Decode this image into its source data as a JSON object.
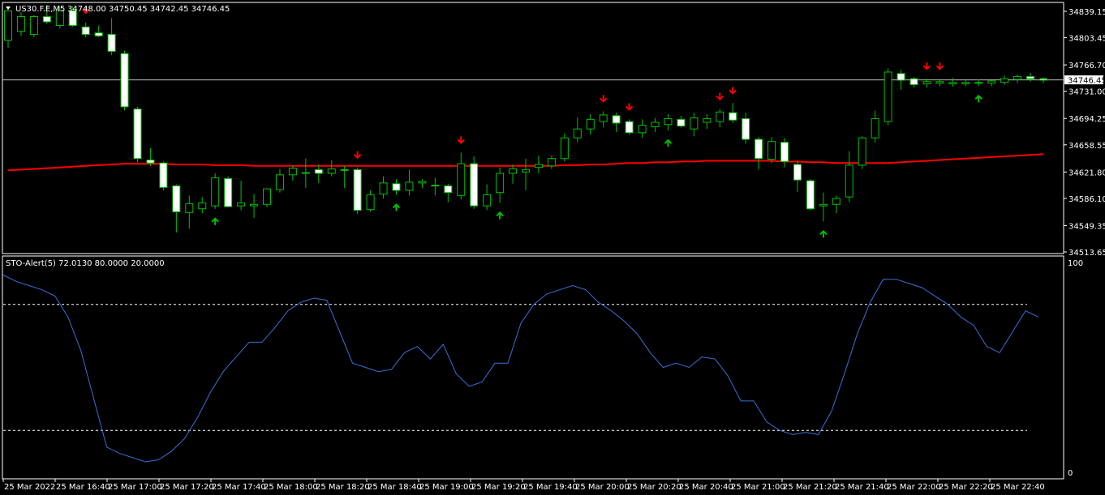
{
  "window": {
    "symbol_title": "US30.F.E,M5",
    "ohlc": "34748.00 34750.45 34742.45 34746.45",
    "indicator_title": "STO-Alert(5) 72.0130 80.0000 20.0000"
  },
  "colors": {
    "background": "#000000",
    "frame": "#ffffff",
    "bull_body": "#000000",
    "bear_body": "#ffffff",
    "wick": "#00c000",
    "ma_line": "#ff0000",
    "stoch_line": "#3b6fd6",
    "level_lines": "#ffffff",
    "arrow_up": "#00c000",
    "arrow_down": "#ff0000",
    "current_price_line": "#c0c0c0"
  },
  "chart_data": [
    {
      "type": "candlestick",
      "symbol": "US30.F.E",
      "timeframe": "M5",
      "current_price": 34746.45,
      "ylim": [
        34513.65,
        34852.0
      ],
      "y_ticks": [
        34839.15,
        34803.45,
        34766.7,
        34731.0,
        34694.25,
        34658.55,
        34621.8,
        34586.1,
        34549.35,
        34513.65
      ],
      "x_tick_labels": [
        "25 Mar 2022",
        "25 Mar 16:40",
        "25 Mar 17:00",
        "25 Mar 17:20",
        "25 Mar 17:40",
        "25 Mar 18:00",
        "25 Mar 18:20",
        "25 Mar 18:40",
        "25 Mar 19:00",
        "25 Mar 19:20",
        "25 Mar 19:40",
        "25 Mar 20:00",
        "25 Mar 20:20",
        "25 Mar 20:40",
        "25 Mar 21:00",
        "25 Mar 21:20",
        "25 Mar 21:40",
        "25 Mar 22:00",
        "25 Mar 22:20",
        "25 Mar 22:40"
      ],
      "candles": [
        {
          "o": 34800,
          "h": 34845,
          "l": 34790,
          "c": 34840
        },
        {
          "o": 34812,
          "h": 34838,
          "l": 34806,
          "c": 34832
        },
        {
          "o": 34808,
          "h": 34834,
          "l": 34804,
          "c": 34832
        },
        {
          "o": 34832,
          "h": 34848,
          "l": 34822,
          "c": 34825
        },
        {
          "o": 34820,
          "h": 34846,
          "l": 34816,
          "c": 34840
        },
        {
          "o": 34840,
          "h": 34846,
          "l": 34818,
          "c": 34820
        },
        {
          "o": 34818,
          "h": 34824,
          "l": 34804,
          "c": 34808
        },
        {
          "o": 34810,
          "h": 34820,
          "l": 34804,
          "c": 34806
        },
        {
          "o": 34808,
          "h": 34830,
          "l": 34780,
          "c": 34785
        },
        {
          "o": 34782,
          "h": 34786,
          "l": 34705,
          "c": 34710
        },
        {
          "o": 34707,
          "h": 34710,
          "l": 34635,
          "c": 34640
        },
        {
          "o": 34638,
          "h": 34654,
          "l": 34630,
          "c": 34634
        },
        {
          "o": 34634,
          "h": 34636,
          "l": 34597,
          "c": 34601
        },
        {
          "o": 34603,
          "h": 34605,
          "l": 34540,
          "c": 34568
        },
        {
          "o": 34567,
          "h": 34590,
          "l": 34545,
          "c": 34579
        },
        {
          "o": 34572,
          "h": 34588,
          "l": 34566,
          "c": 34580
        },
        {
          "o": 34576,
          "h": 34620,
          "l": 34572,
          "c": 34614
        },
        {
          "o": 34613,
          "h": 34616,
          "l": 34574,
          "c": 34575
        },
        {
          "o": 34576,
          "h": 34610,
          "l": 34570,
          "c": 34580
        },
        {
          "o": 34576,
          "h": 34592,
          "l": 34560,
          "c": 34578
        },
        {
          "o": 34578,
          "h": 34600,
          "l": 34574,
          "c": 34599
        },
        {
          "o": 34598,
          "h": 34626,
          "l": 34594,
          "c": 34618
        },
        {
          "o": 34618,
          "h": 34630,
          "l": 34610,
          "c": 34627
        },
        {
          "o": 34620,
          "h": 34640,
          "l": 34600,
          "c": 34621
        },
        {
          "o": 34625,
          "h": 34632,
          "l": 34607,
          "c": 34620
        },
        {
          "o": 34620,
          "h": 34638,
          "l": 34616,
          "c": 34626
        },
        {
          "o": 34625,
          "h": 34630,
          "l": 34600,
          "c": 34624
        },
        {
          "o": 34625,
          "h": 34628,
          "l": 34565,
          "c": 34570
        },
        {
          "o": 34571,
          "h": 34597,
          "l": 34568,
          "c": 34591
        },
        {
          "o": 34592,
          "h": 34616,
          "l": 34586,
          "c": 34607
        },
        {
          "o": 34606,
          "h": 34612,
          "l": 34591,
          "c": 34597
        },
        {
          "o": 34597,
          "h": 34625,
          "l": 34590,
          "c": 34608
        },
        {
          "o": 34607,
          "h": 34612,
          "l": 34600,
          "c": 34609
        },
        {
          "o": 34604,
          "h": 34614,
          "l": 34590,
          "c": 34603
        },
        {
          "o": 34603,
          "h": 34606,
          "l": 34581,
          "c": 34594
        },
        {
          "o": 34590,
          "h": 34648,
          "l": 34585,
          "c": 34633
        },
        {
          "o": 34633,
          "h": 34643,
          "l": 34572,
          "c": 34576
        },
        {
          "o": 34576,
          "h": 34605,
          "l": 34570,
          "c": 34591
        },
        {
          "o": 34594,
          "h": 34628,
          "l": 34580,
          "c": 34620
        },
        {
          "o": 34620,
          "h": 34632,
          "l": 34606,
          "c": 34626
        },
        {
          "o": 34622,
          "h": 34640,
          "l": 34597,
          "c": 34625
        },
        {
          "o": 34628,
          "h": 34644,
          "l": 34620,
          "c": 34632
        },
        {
          "o": 34630,
          "h": 34644,
          "l": 34626,
          "c": 34640
        },
        {
          "o": 34640,
          "h": 34674,
          "l": 34636,
          "c": 34668
        },
        {
          "o": 34668,
          "h": 34696,
          "l": 34662,
          "c": 34680
        },
        {
          "o": 34680,
          "h": 34700,
          "l": 34672,
          "c": 34693
        },
        {
          "o": 34690,
          "h": 34704,
          "l": 34682,
          "c": 34699
        },
        {
          "o": 34698,
          "h": 34702,
          "l": 34676,
          "c": 34688
        },
        {
          "o": 34690,
          "h": 34693,
          "l": 34672,
          "c": 34675
        },
        {
          "o": 34675,
          "h": 34693,
          "l": 34668,
          "c": 34685
        },
        {
          "o": 34683,
          "h": 34695,
          "l": 34676,
          "c": 34689
        },
        {
          "o": 34686,
          "h": 34700,
          "l": 34678,
          "c": 34694
        },
        {
          "o": 34693,
          "h": 34698,
          "l": 34682,
          "c": 34684
        },
        {
          "o": 34680,
          "h": 34702,
          "l": 34670,
          "c": 34695
        },
        {
          "o": 34689,
          "h": 34700,
          "l": 34680,
          "c": 34694
        },
        {
          "o": 34690,
          "h": 34707,
          "l": 34682,
          "c": 34703
        },
        {
          "o": 34702,
          "h": 34715,
          "l": 34688,
          "c": 34692
        },
        {
          "o": 34694,
          "h": 34702,
          "l": 34660,
          "c": 34666
        },
        {
          "o": 34666,
          "h": 34669,
          "l": 34625,
          "c": 34640
        },
        {
          "o": 34639,
          "h": 34669,
          "l": 34634,
          "c": 34663
        },
        {
          "o": 34662,
          "h": 34668,
          "l": 34628,
          "c": 34636
        },
        {
          "o": 34632,
          "h": 34637,
          "l": 34595,
          "c": 34611
        },
        {
          "o": 34610,
          "h": 34612,
          "l": 34570,
          "c": 34572
        },
        {
          "o": 34576,
          "h": 34594,
          "l": 34555,
          "c": 34578
        },
        {
          "o": 34578,
          "h": 34590,
          "l": 34566,
          "c": 34586
        },
        {
          "o": 34588,
          "h": 34650,
          "l": 34581,
          "c": 34631
        },
        {
          "o": 34631,
          "h": 34670,
          "l": 34626,
          "c": 34668
        },
        {
          "o": 34668,
          "h": 34705,
          "l": 34662,
          "c": 34694
        },
        {
          "o": 34690,
          "h": 34762,
          "l": 34685,
          "c": 34757
        },
        {
          "o": 34755,
          "h": 34760,
          "l": 34733,
          "c": 34746
        },
        {
          "o": 34748,
          "h": 34750,
          "l": 34736,
          "c": 34740
        },
        {
          "o": 34741,
          "h": 34748,
          "l": 34736,
          "c": 34744
        },
        {
          "o": 34742,
          "h": 34748,
          "l": 34738,
          "c": 34744
        },
        {
          "o": 34741,
          "h": 34749,
          "l": 34737,
          "c": 34743
        },
        {
          "o": 34741,
          "h": 34746,
          "l": 34738,
          "c": 34743
        },
        {
          "o": 34742,
          "h": 34747,
          "l": 34738,
          "c": 34743
        },
        {
          "o": 34742,
          "h": 34748,
          "l": 34738,
          "c": 34745
        },
        {
          "o": 34743,
          "h": 34752,
          "l": 34740,
          "c": 34748
        },
        {
          "o": 34747,
          "h": 34754,
          "l": 34742,
          "c": 34751
        },
        {
          "o": 34751,
          "h": 34756,
          "l": 34744,
          "c": 34748
        },
        {
          "o": 34748,
          "h": 34750,
          "l": 34742,
          "c": 34746
        }
      ],
      "ma_series": [
        34624,
        34625,
        34626,
        34627,
        34628,
        34629,
        34630,
        34631,
        34632,
        34633,
        34633,
        34633,
        34633,
        34632,
        34632,
        34632,
        34631,
        34631,
        34631,
        34630,
        34630,
        34630,
        34630,
        34630,
        34630,
        34630,
        34630,
        34630,
        34630,
        34630,
        34630,
        34630,
        34630,
        34630,
        34630,
        34630,
        34630,
        34630,
        34630,
        34630,
        34630,
        34630,
        34630,
        34631,
        34631,
        34632,
        34632,
        34633,
        34634,
        34634,
        34635,
        34635,
        34636,
        34636,
        34637,
        34637,
        34637,
        34637,
        34637,
        34637,
        34636,
        34636,
        34635,
        34635,
        34634,
        34634,
        34634,
        34634,
        34634,
        34635,
        34636,
        34637,
        34638,
        34639,
        34640,
        34641,
        34642,
        34643,
        34644,
        34645,
        34646
      ],
      "arrows_down": [
        6,
        27,
        35,
        46,
        48,
        55,
        56,
        71,
        72
      ],
      "arrows_up": [
        16,
        30,
        38,
        51,
        63,
        75
      ]
    },
    {
      "type": "line",
      "name": "STO-Alert(5)",
      "ylim": [
        0,
        100
      ],
      "y_ticks": [
        100,
        0
      ],
      "levels": [
        80,
        20
      ],
      "values": [
        94,
        91,
        89,
        87,
        84,
        74,
        58,
        35,
        12,
        9,
        7,
        5,
        6,
        10,
        16,
        26,
        38,
        48,
        55,
        62,
        62,
        69,
        77,
        81,
        83,
        82,
        67,
        52,
        50,
        48,
        49,
        57,
        60,
        54,
        61,
        47,
        41,
        43,
        52,
        52,
        71,
        80,
        85,
        87,
        89,
        87,
        81,
        77,
        72,
        66,
        57,
        50,
        52,
        50,
        55,
        54,
        46,
        34,
        34,
        24,
        20,
        18,
        19,
        18,
        29,
        47,
        66,
        81,
        92,
        92,
        90,
        88,
        84,
        80,
        74,
        70,
        60,
        57,
        67,
        77,
        74
      ]
    }
  ]
}
